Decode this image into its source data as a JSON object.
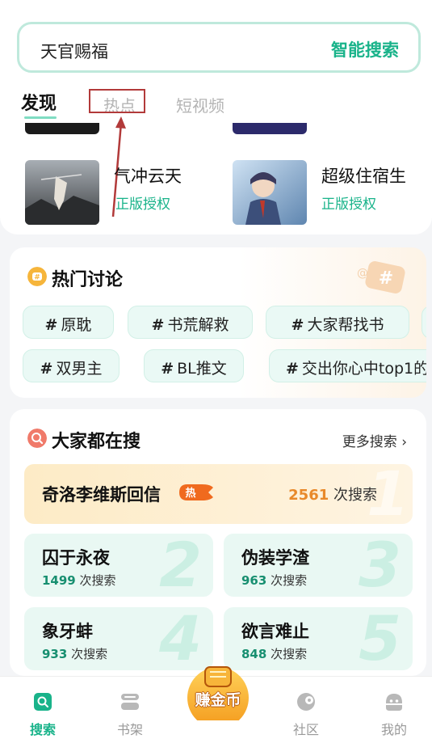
{
  "search": {
    "value": "天官赐福",
    "button_label": "智能搜索"
  },
  "tabs": [
    {
      "label": "发现",
      "active": true
    },
    {
      "label": "热点",
      "active": false
    },
    {
      "label": "短视频",
      "active": false
    }
  ],
  "books": [
    {
      "title": "气冲云天",
      "tag": "正版授权",
      "cover_color": "#6b6f72"
    },
    {
      "title": "超级住宿生",
      "tag": "正版授权",
      "cover_color": "#7fa3c9"
    }
  ],
  "hot_discussion": {
    "title": "热门讨论",
    "topics_row1": [
      "原耽",
      "书荒解救",
      "大家帮找书"
    ],
    "topics_row2": [
      "双男主",
      "BL推文",
      "交出你心中top1的"
    ]
  },
  "popular_search": {
    "title": "大家都在搜",
    "more_label": "更多搜索",
    "unit": "次搜索",
    "top_item": {
      "rank": "1",
      "title": "奇洛李维斯回信",
      "badge": "热",
      "count": "2561"
    },
    "items": [
      {
        "rank": "2",
        "title": "囚于永夜",
        "count": "1499"
      },
      {
        "rank": "3",
        "title": "伪装学渣",
        "count": "963"
      },
      {
        "rank": "4",
        "title": "象牙蚌",
        "count": "933"
      },
      {
        "rank": "5",
        "title": "欲言难止",
        "count": "848"
      }
    ]
  },
  "bottom_nav": [
    {
      "label": "搜索",
      "icon": "search-icon",
      "active": true
    },
    {
      "label": "书架",
      "icon": "bookshelf-icon",
      "active": false
    },
    {
      "label": "赚金币",
      "icon": "coin-icon",
      "active": false
    },
    {
      "label": "社区",
      "icon": "community-icon",
      "active": false
    },
    {
      "label": "我的",
      "icon": "profile-icon",
      "active": false
    }
  ],
  "colors": {
    "accent": "#19b38a",
    "hot": "#e8892a",
    "annotation": "#b23a3a"
  }
}
